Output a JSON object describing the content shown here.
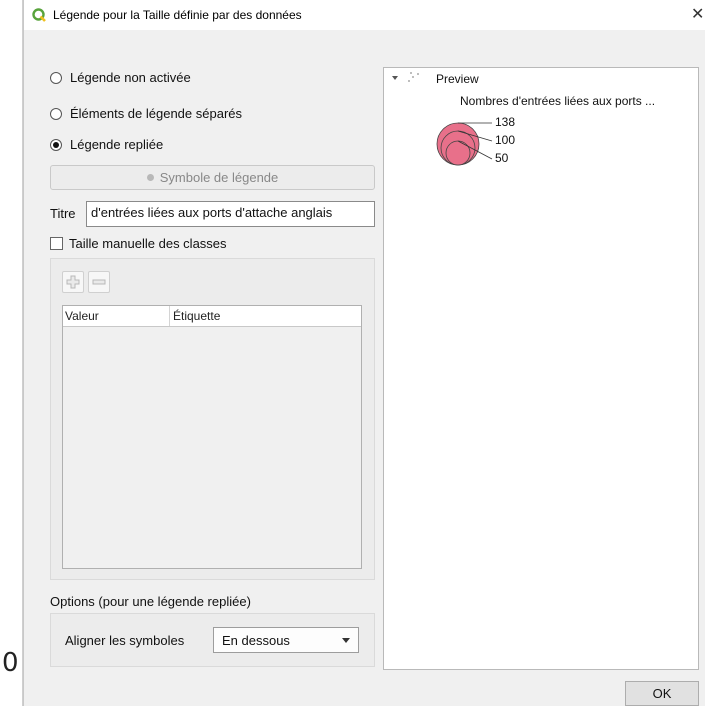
{
  "background_fragment": {
    "text": "0"
  },
  "window": {
    "title": "Légende pour la Taille définie par des données",
    "close_symbol": "✕",
    "app_icon": "qgis-icon"
  },
  "legend_mode": {
    "options": [
      {
        "label": "Légende non activée",
        "selected": false
      },
      {
        "label": "Éléments de légende séparés",
        "selected": false
      },
      {
        "label": "Légende repliée",
        "selected": true
      }
    ]
  },
  "symbol_button": {
    "label": "Symbole de légende",
    "enabled": false
  },
  "title_field": {
    "label": "Titre",
    "value": "d'entrées liées aux ports d'attache anglais"
  },
  "manual_classes": {
    "label": "Taille manuelle des classes",
    "checked": false
  },
  "classes_table": {
    "add_icon": "plus-icon",
    "remove_icon": "minus-icon",
    "columns": [
      "Valeur",
      "Étiquette"
    ],
    "rows": []
  },
  "options": {
    "label": "Options (pour une légende repliée)",
    "align_label": "Aligner les symboles",
    "align_value": "En dessous"
  },
  "preview": {
    "label": "Preview",
    "legend_title": "Nombres d'entrées liées aux ports ...",
    "values": [
      "138",
      "100",
      "50"
    ],
    "symbol_color": "#e8708a"
  },
  "ok_button": {
    "label": "OK"
  }
}
